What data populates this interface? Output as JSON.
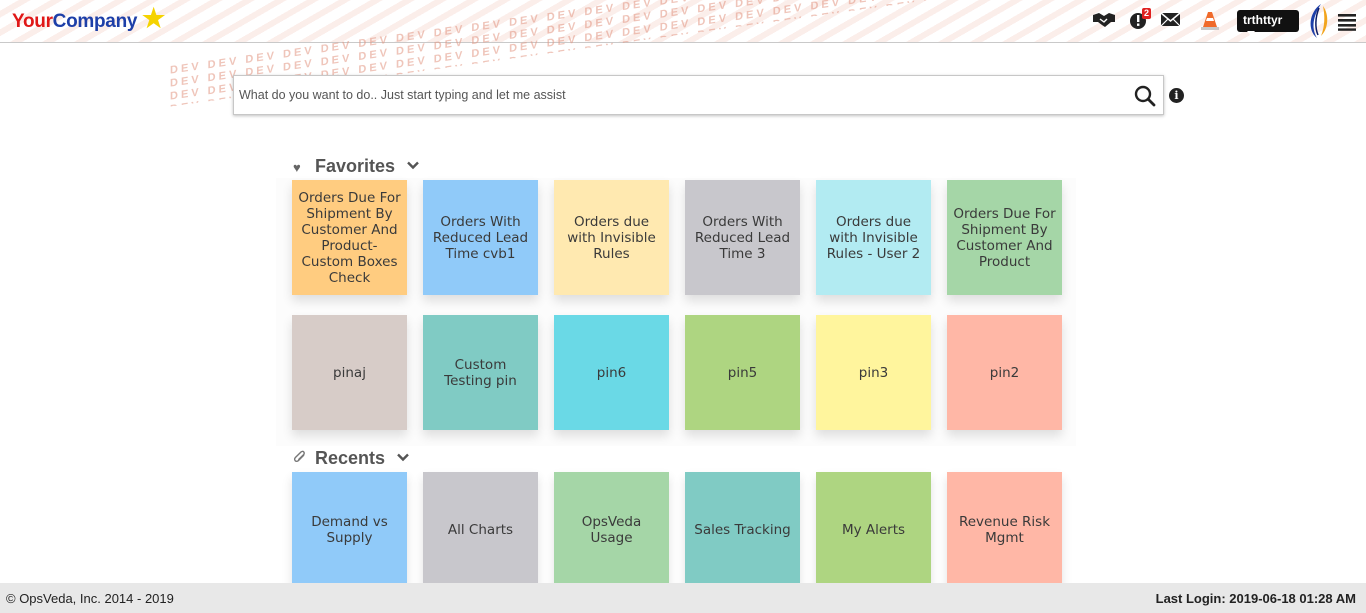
{
  "header": {
    "logo_part1": "Your",
    "logo_part2": "Company",
    "watermark": "DEV",
    "notification_count": "2",
    "user_name": "trthttyr"
  },
  "search": {
    "placeholder": "What do you want to do.. Just start typing and let me assist",
    "value": ""
  },
  "favorites": {
    "title": "Favorites",
    "tiles": [
      {
        "label": "Orders Due For Shipment By Customer And Product- Custom Boxes Check",
        "color": "#ffcc80"
      },
      {
        "label": "Orders With Reduced Lead Time cvb1",
        "color": "#90caf9"
      },
      {
        "label": "Orders due with Invisible Rules",
        "color": "#ffe9b0"
      },
      {
        "label": "Orders With Reduced Lead Time 3",
        "color": "#c8c7cc"
      },
      {
        "label": "Orders due with Invisible Rules - User 2",
        "color": "#b2ebf2"
      },
      {
        "label": "Orders Due For Shipment By Customer And Product",
        "color": "#a5d6a7"
      },
      {
        "label": "pinaj",
        "color": "#d7ccc8"
      },
      {
        "label": "Custom Testing pin",
        "color": "#80cbc4"
      },
      {
        "label": "pin6",
        "color": "#6ad9e6"
      },
      {
        "label": "pin5",
        "color": "#aed581"
      },
      {
        "label": "pin3",
        "color": "#fff59d"
      },
      {
        "label": "pin2",
        "color": "#ffb7a6"
      }
    ]
  },
  "recents": {
    "title": "Recents",
    "tiles": [
      {
        "label": "Demand vs Supply",
        "color": "#90caf9"
      },
      {
        "label": "All Charts",
        "color": "#c8c7cc"
      },
      {
        "label": "OpsVeda Usage",
        "color": "#a5d6a7"
      },
      {
        "label": "Sales Tracking",
        "color": "#80cbc4"
      },
      {
        "label": "My Alerts",
        "color": "#aed581"
      },
      {
        "label": "Revenue Risk Mgmt",
        "color": "#ffb7a6"
      }
    ]
  },
  "footer": {
    "copyright": "© OpsVeda, Inc. 2014 - 2019",
    "last_login": "Last Login: 2019-06-18 01:28 AM"
  }
}
